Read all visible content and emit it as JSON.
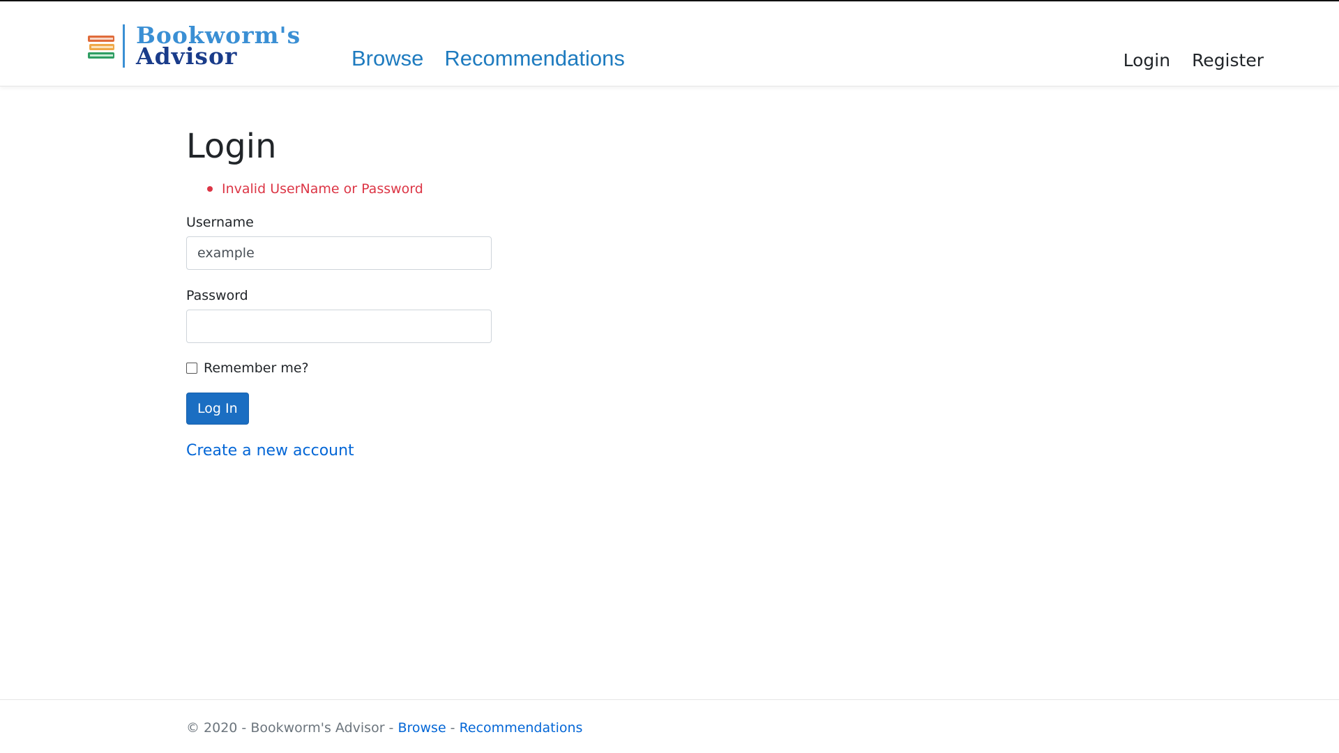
{
  "brand": {
    "line1": "Bookworm's",
    "line2": "Advisor",
    "colors": {
      "line1": "#3a8fd4",
      "line2": "#1a3c8a"
    }
  },
  "nav": {
    "left": [
      {
        "label": "Browse"
      },
      {
        "label": "Recommendations"
      }
    ],
    "right": [
      {
        "label": "Login"
      },
      {
        "label": "Register"
      }
    ]
  },
  "login": {
    "title": "Login",
    "errors": [
      "Invalid UserName or Password"
    ],
    "username_label": "Username",
    "username_value": "example",
    "password_label": "Password",
    "password_value": "",
    "remember_label": "Remember me?",
    "remember_checked": false,
    "submit_label": "Log In",
    "create_account_label": "Create a new account"
  },
  "footer": {
    "copyright": "© 2020 - Bookworm's Advisor - ",
    "separator": " - ",
    "links": [
      "Browse",
      "Recommendations"
    ]
  },
  "colors": {
    "accent": "#1b6ec2",
    "link": "#0366d6",
    "nav_link": "#1e7bbf",
    "error": "#dc3545"
  }
}
